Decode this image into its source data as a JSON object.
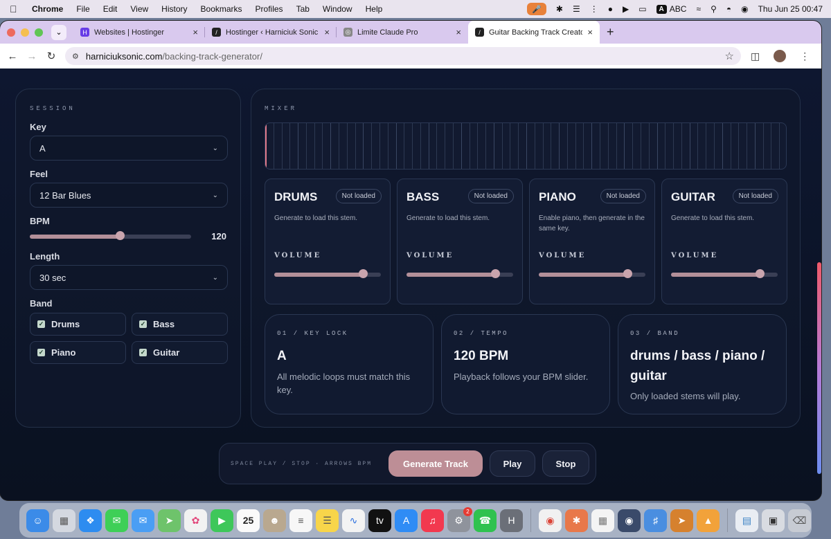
{
  "menubar": {
    "app": "Chrome",
    "items": [
      "File",
      "Edit",
      "View",
      "History",
      "Bookmarks",
      "Profiles",
      "Tab",
      "Window",
      "Help"
    ],
    "input_source": "A",
    "input_label": "ABC",
    "clock": "Thu Jun 25  00:47"
  },
  "browser": {
    "tabs": [
      {
        "label": "Websites | Hostinger",
        "favicon_color": "#673de6",
        "active": false
      },
      {
        "label": "Hostinger ‹ Harniciuk Sonic —",
        "favicon_color": "#222222",
        "active": false
      },
      {
        "label": "Limite Claude Pro",
        "favicon_color": "#888888",
        "active": false
      },
      {
        "label": "Guitar Backing Track Creator",
        "favicon_color": "#222222",
        "active": true
      }
    ],
    "url_host": "harniciuksonic.com",
    "url_path": "/backing-track-generator/"
  },
  "session": {
    "eyebrow": "SESSION",
    "key_label": "Key",
    "key_value": "A",
    "feel_label": "Feel",
    "feel_value": "12 Bar Blues",
    "bpm_label": "BPM",
    "bpm_value": "120",
    "bpm_fraction": 0.56,
    "length_label": "Length",
    "length_value": "30 sec",
    "band_label": "Band",
    "band": [
      "Drums",
      "Bass",
      "Piano",
      "Guitar"
    ]
  },
  "mixer": {
    "eyebrow": "MIXER",
    "stems": [
      {
        "name": "DRUMS",
        "status": "Not loaded",
        "desc": "Generate to load this stem.",
        "volume_label": "VOLUME",
        "volume": 0.83
      },
      {
        "name": "BASS",
        "status": "Not loaded",
        "desc": "Generate to load this stem.",
        "volume_label": "VOLUME",
        "volume": 0.83
      },
      {
        "name": "PIANO",
        "status": "Not loaded",
        "desc": "Enable piano, then generate in the same key.",
        "volume_label": "VOLUME",
        "volume": 0.83
      },
      {
        "name": "GUITAR",
        "status": "Not loaded",
        "desc": "Generate to load this stem.",
        "volume_label": "VOLUME",
        "volume": 0.83
      }
    ],
    "cards": [
      {
        "tag": "01 / KEY LOCK",
        "value": "A",
        "desc": "All melodic loops must match this key."
      },
      {
        "tag": "02 / TEMPO",
        "value": "120 BPM",
        "desc": "Playback follows your BPM slider."
      },
      {
        "tag": "03 / BAND",
        "value": "drums / bass / piano / guitar",
        "desc": "Only loaded stems will play."
      }
    ]
  },
  "controls": {
    "hint": "SPACE PLAY / STOP · ARROWS BPM",
    "generate": "Generate Track",
    "play": "Play",
    "stop": "Stop"
  },
  "dock": {
    "calendar_day": "25",
    "settings_badge": "2",
    "h_app": "H"
  }
}
